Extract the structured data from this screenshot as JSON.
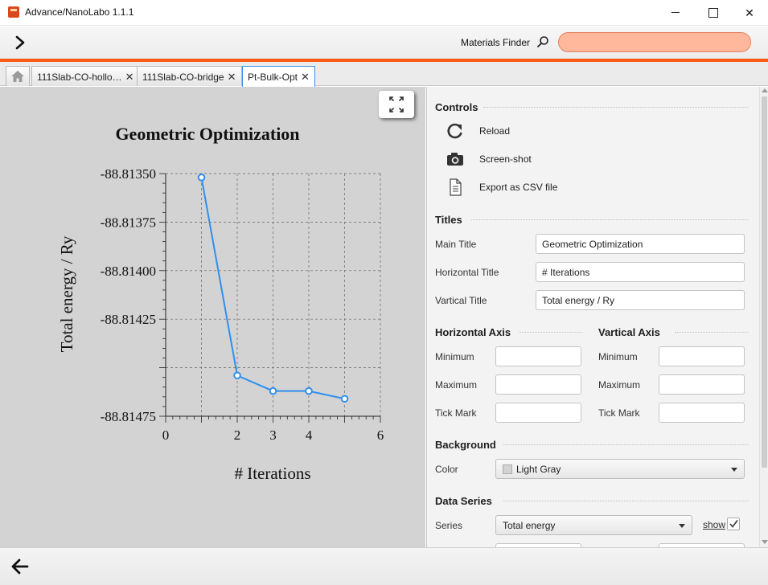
{
  "window": {
    "title": "Advance/NanoLabo 1.1.1"
  },
  "toolbar": {
    "materials_finder_label": "Materials Finder",
    "search_value": "",
    "search_placeholder": ""
  },
  "tabs": [
    {
      "label": "111Slab-CO-hollo…"
    },
    {
      "label": "111Slab-CO-bridge"
    },
    {
      "label": "Pt-Bulk-Opt",
      "active": true
    }
  ],
  "colors": {
    "accent": "#ff5a14",
    "search_bg": "#ffb89c",
    "plot_bg": "#d3d3d3",
    "series": "#2f8ff0"
  },
  "chart_data": {
    "type": "line",
    "title": "Geometric Optimization",
    "xlabel": "# Iterations",
    "ylabel": "Total energy / Ry",
    "xlim": [
      0,
      6
    ],
    "ylim": [
      -88.81475,
      -88.8135
    ],
    "xticks": [
      "0",
      "2",
      "3",
      "4",
      "6"
    ],
    "yticks": [
      "-88.81350",
      "-88.81375",
      "-88.81400",
      "-88.81425",
      "-88.81475"
    ],
    "grid": true,
    "series": [
      {
        "x": [
          1,
          2,
          3,
          4,
          5
        ],
        "y": [
          -88.81352,
          -88.81454,
          -88.81462,
          -88.81462,
          -88.81466
        ]
      }
    ]
  },
  "controls": {
    "title": "Controls",
    "reload": "Reload",
    "screenshot": "Screen-shot",
    "export": "Export as CSV file"
  },
  "titles": {
    "title": "Titles",
    "main_label": "Main Title",
    "main_value": "Geometric Optimization",
    "horizontal_label": "Horizontal Title",
    "horizontal_value": "# Iterations",
    "vertical_label": "Vartical Title",
    "vertical_value": "Total energy / Ry"
  },
  "horizontal_axis": {
    "title": "Horizontal Axis",
    "min_label": "Minimum",
    "max_label": "Maximum",
    "tick_label": "Tick Mark",
    "min": "",
    "max": "",
    "tick": ""
  },
  "vertical_axis": {
    "title": "Vartical Axis",
    "min_label": "Minimum",
    "max_label": "Maximum",
    "tick_label": "Tick Mark",
    "min": "",
    "max": "",
    "tick": ""
  },
  "background": {
    "title": "Background",
    "color_label": "Color",
    "color_value": "Light Gray"
  },
  "data_series": {
    "title": "Data Series",
    "series_label": "Series",
    "series_value": "Total energy",
    "show_label": "show",
    "show_checked": true
  }
}
